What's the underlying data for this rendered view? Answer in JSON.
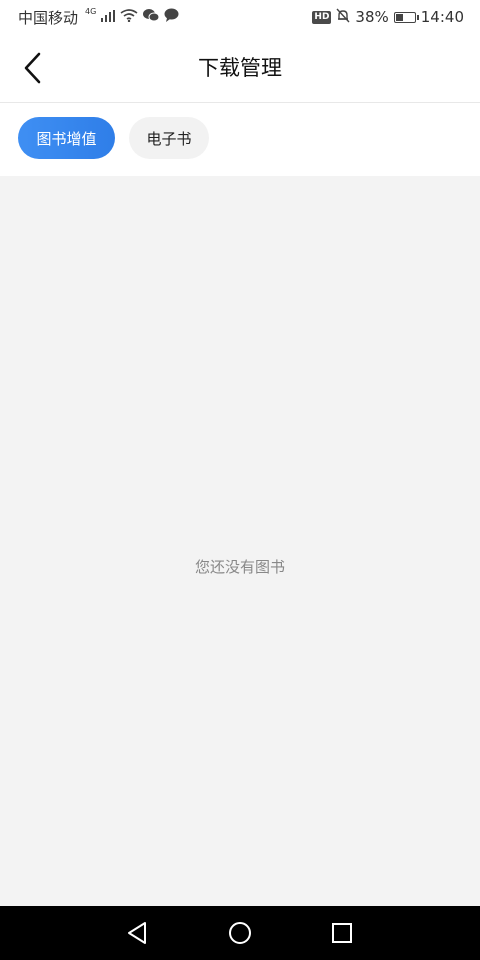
{
  "status_bar": {
    "carrier": "中国移动",
    "network": "4G",
    "hd": "HD",
    "battery_percent": "38%",
    "battery_level": 0.38,
    "time": "14:40"
  },
  "header": {
    "title": "下载管理",
    "back_icon": "back-arrow-icon"
  },
  "tabs": [
    {
      "label": "图书增值",
      "active": true
    },
    {
      "label": "电子书",
      "active": false
    }
  ],
  "main": {
    "empty_message": "您还没有图书"
  },
  "system_nav": {
    "icons": [
      "back-triangle-icon",
      "home-circle-icon",
      "recents-square-icon"
    ]
  },
  "colors": {
    "accent": "#2f7ee8",
    "content_bg": "#f3f3f3",
    "empty_text": "#888888"
  }
}
